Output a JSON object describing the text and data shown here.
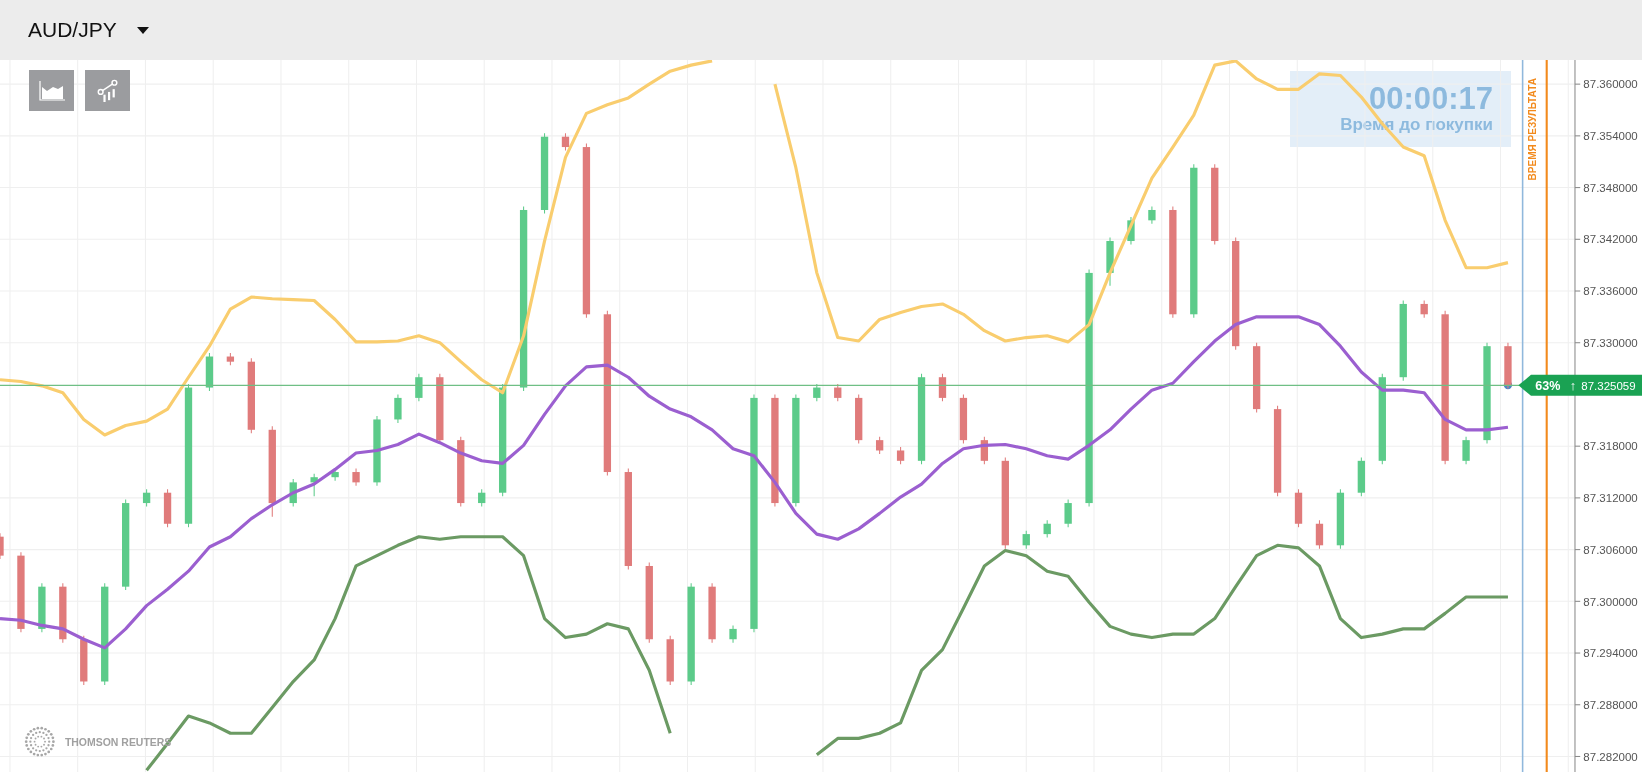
{
  "header": {
    "symbol": "AUD/JPY"
  },
  "timer": {
    "time": "00:00:17",
    "label": "Время до покупки"
  },
  "expiry_label": "ВРЕМЯ РЕЗУЛЬТАТА",
  "price_tag": {
    "percent": "63%",
    "arrow": "↑"
  },
  "provider": "THOMSON REUTERS",
  "chart_data": {
    "type": "candlestick",
    "grid": true,
    "ylim": [
      87.2802,
      87.3628
    ],
    "yticks": [
      {
        "value": 87.36,
        "label": "87.360000"
      },
      {
        "value": 87.354,
        "label": "87.354000"
      },
      {
        "value": 87.348,
        "label": "87.348000"
      },
      {
        "value": 87.342,
        "label": "87.342000"
      },
      {
        "value": 87.336,
        "label": "87.336000"
      },
      {
        "value": 87.33,
        "label": "87.330000"
      },
      {
        "value": 87.318,
        "label": "87.318000"
      },
      {
        "value": 87.312,
        "label": "87.312000"
      },
      {
        "value": 87.306,
        "label": "87.306000"
      },
      {
        "value": 87.3,
        "label": "87.300000"
      },
      {
        "value": 87.294,
        "label": "87.294000"
      },
      {
        "value": 87.288,
        "label": "87.288000"
      },
      {
        "value": 87.282,
        "label": "87.282000"
      }
    ],
    "ohlc": [
      [
        87.3075,
        87.3079,
        87.3049,
        87.3053
      ],
      [
        87.3053,
        87.3057,
        87.2964,
        87.2968
      ],
      [
        87.2968,
        87.3021,
        87.2964,
        87.3017
      ],
      [
        87.3017,
        87.3021,
        87.2952,
        87.2956
      ],
      [
        87.2956,
        87.296,
        87.2903,
        87.2907
      ],
      [
        87.2907,
        87.3021,
        87.2903,
        87.3017
      ],
      [
        87.3017,
        87.3118,
        87.3013,
        87.3114
      ],
      [
        87.3114,
        87.313,
        87.311,
        87.3126
      ],
      [
        87.3126,
        87.313,
        87.3086,
        87.309
      ],
      [
        87.309,
        87.3252,
        87.3086,
        87.3248
      ],
      [
        87.3248,
        87.3288,
        87.3244,
        87.3284
      ],
      [
        87.3284,
        87.3288,
        87.3274,
        87.3278
      ],
      [
        87.3278,
        87.3282,
        87.3195,
        87.3199
      ],
      [
        87.3199,
        87.3203,
        87.3098,
        87.3114
      ],
      [
        87.3114,
        87.3142,
        87.311,
        87.3138
      ],
      [
        87.3138,
        87.3148,
        87.3122,
        87.3144
      ],
      [
        87.3144,
        87.3154,
        87.314,
        87.315
      ],
      [
        87.315,
        87.3154,
        87.3134,
        87.3138
      ],
      [
        87.3138,
        87.3215,
        87.3134,
        87.3211
      ],
      [
        87.3211,
        87.324,
        87.3207,
        87.3236
      ],
      [
        87.3236,
        87.3264,
        87.3232,
        87.326
      ],
      [
        87.326,
        87.3264,
        87.3183,
        87.3187
      ],
      [
        87.3187,
        87.3191,
        87.311,
        87.3114
      ],
      [
        87.3114,
        87.313,
        87.311,
        87.3126
      ],
      [
        87.3126,
        87.3252,
        87.3122,
        87.3248
      ],
      [
        87.3248,
        87.3458,
        87.3244,
        87.3454
      ],
      [
        87.3454,
        87.3543,
        87.345,
        87.3539
      ],
      [
        87.3539,
        87.3543,
        87.3523,
        87.3527
      ],
      [
        87.3527,
        87.3531,
        87.3329,
        87.3333
      ],
      [
        87.3333,
        87.3337,
        87.3146,
        87.315
      ],
      [
        87.315,
        87.3154,
        87.3037,
        87.3041
      ],
      [
        87.3041,
        87.3045,
        87.2952,
        87.2956
      ],
      [
        87.2956,
        87.296,
        87.2903,
        87.2907
      ],
      [
        87.2907,
        87.3021,
        87.2903,
        87.3017
      ],
      [
        87.3017,
        87.3021,
        87.2952,
        87.2956
      ],
      [
        87.2956,
        87.2972,
        87.2952,
        87.2968
      ],
      [
        87.2968,
        87.324,
        87.2964,
        87.3236
      ],
      [
        87.3236,
        87.324,
        87.311,
        87.3114
      ],
      [
        87.3114,
        87.324,
        87.311,
        87.3236
      ],
      [
        87.3236,
        87.3252,
        87.3232,
        87.3248
      ],
      [
        87.3248,
        87.3252,
        87.3232,
        87.3236
      ],
      [
        87.3236,
        87.324,
        87.3183,
        87.3187
      ],
      [
        87.3187,
        87.3191,
        87.3171,
        87.3175
      ],
      [
        87.3175,
        87.3179,
        87.3159,
        87.3163
      ],
      [
        87.3163,
        87.3264,
        87.3159,
        87.326
      ],
      [
        87.326,
        87.3264,
        87.3232,
        87.3236
      ],
      [
        87.3236,
        87.324,
        87.3183,
        87.3187
      ],
      [
        87.3187,
        87.3191,
        87.3159,
        87.3163
      ],
      [
        87.3163,
        87.3167,
        87.3061,
        87.3065
      ],
      [
        87.3065,
        87.3082,
        87.3061,
        87.3078
      ],
      [
        87.3078,
        87.3094,
        87.3074,
        87.309
      ],
      [
        87.309,
        87.3118,
        87.3086,
        87.3114
      ],
      [
        87.3114,
        87.3385,
        87.311,
        87.3381
      ],
      [
        87.3381,
        87.3422,
        87.3366,
        87.3418
      ],
      [
        87.3418,
        87.3446,
        87.3414,
        87.3442
      ],
      [
        87.3442,
        87.3458,
        87.3438,
        87.3454
      ],
      [
        87.3454,
        87.3458,
        87.3329,
        87.3333
      ],
      [
        87.3333,
        87.3507,
        87.3329,
        87.3503
      ],
      [
        87.3503,
        87.3507,
        87.3414,
        87.3418
      ],
      [
        87.3418,
        87.3422,
        87.3292,
        87.3296
      ],
      [
        87.3296,
        87.33,
        87.3219,
        87.3223
      ],
      [
        87.3223,
        87.3227,
        87.3122,
        87.3126
      ],
      [
        87.3126,
        87.313,
        87.3086,
        87.309
      ],
      [
        87.309,
        87.3094,
        87.3061,
        87.3065
      ],
      [
        87.3065,
        87.313,
        87.3061,
        87.3126
      ],
      [
        87.3126,
        87.3167,
        87.3122,
        87.3163
      ],
      [
        87.3163,
        87.3264,
        87.3159,
        87.326
      ],
      [
        87.326,
        87.3349,
        87.3256,
        87.3345
      ],
      [
        87.3345,
        87.3349,
        87.3329,
        87.3333
      ],
      [
        87.3333,
        87.3337,
        87.3159,
        87.3163
      ],
      [
        87.3163,
        87.3191,
        87.3159,
        87.3187
      ],
      [
        87.3187,
        87.33,
        87.3183,
        87.3296
      ],
      [
        87.3296,
        87.33,
        87.3247,
        87.3251
      ]
    ],
    "series": [
      {
        "type": "line",
        "color": "#f9cd6e",
        "values": [
          87.3257,
          87.3255,
          87.325,
          87.3242,
          87.3211,
          87.3193,
          87.3204,
          87.3209,
          87.3223,
          87.326,
          87.3296,
          87.3339,
          87.3353,
          87.3351,
          87.335,
          87.3349,
          87.3327,
          87.3301,
          87.3301,
          87.3302,
          87.3308,
          87.33,
          87.3278,
          87.3257,
          87.3242,
          87.3308,
          87.3418,
          87.3515,
          87.3566,
          87.3576,
          87.3584,
          87.36,
          87.3615,
          87.3622,
          87.3627,
          null,
          null,
          87.36,
          87.3503,
          87.3381,
          87.3306,
          87.3302,
          87.3327,
          87.3335,
          87.3342,
          87.3345,
          87.3333,
          87.3314,
          87.3302,
          87.3306,
          87.3308,
          87.3301,
          87.3321,
          87.3381,
          87.3436,
          87.3491,
          87.3527,
          87.3564,
          87.3622,
          87.3627,
          87.3606,
          87.3594,
          87.3594,
          87.3612,
          87.361,
          87.3585,
          87.3554,
          87.3527,
          87.3517,
          87.3442,
          87.3387,
          87.3387,
          87.3393
        ]
      },
      {
        "type": "line",
        "color": "#9b5fd0",
        "values": [
          87.298,
          87.2978,
          87.2972,
          87.2968,
          87.2956,
          87.2946,
          87.2968,
          87.2995,
          87.3014,
          87.3035,
          87.3063,
          87.3075,
          87.3096,
          87.3112,
          87.3126,
          87.3136,
          87.3153,
          87.3172,
          87.3175,
          87.3182,
          87.3194,
          87.3184,
          87.3172,
          87.3163,
          87.316,
          87.3181,
          87.3217,
          87.325,
          87.3272,
          87.3274,
          87.326,
          87.3238,
          87.3223,
          87.3214,
          87.3199,
          87.3177,
          87.3169,
          87.3138,
          87.3102,
          87.3078,
          87.3072,
          87.3084,
          87.3102,
          87.3121,
          87.3136,
          87.316,
          87.3177,
          87.3181,
          87.3182,
          87.3177,
          87.3169,
          87.3165,
          87.3181,
          87.3199,
          87.3223,
          87.3245,
          87.3253,
          87.3278,
          87.3302,
          87.3321,
          87.333,
          87.333,
          87.333,
          87.3321,
          87.3296,
          87.3266,
          87.3245,
          87.3245,
          87.3242,
          87.3211,
          87.3199,
          87.3199,
          87.3202
        ]
      },
      {
        "type": "line",
        "color": "#6b9a63",
        "values": [
          null,
          null,
          null,
          null,
          null,
          null,
          null,
          87.2804,
          87.2835,
          87.2867,
          87.2859,
          87.2847,
          87.2847,
          87.2877,
          87.2907,
          87.2932,
          87.298,
          87.3041,
          87.3053,
          87.3065,
          87.3075,
          87.3072,
          87.3075,
          87.3075,
          87.3075,
          87.3053,
          87.298,
          87.2958,
          87.2962,
          87.2974,
          87.2968,
          87.292,
          87.2847,
          null,
          null,
          null,
          null,
          null,
          null,
          87.2822,
          87.2841,
          87.2841,
          87.2847,
          87.2859,
          87.292,
          87.2944,
          87.2992,
          87.3041,
          87.3059,
          87.3053,
          87.3035,
          87.3029,
          87.2999,
          87.2971,
          87.2962,
          87.2958,
          87.2962,
          87.2962,
          87.298,
          87.3017,
          87.3053,
          87.3065,
          87.3062,
          87.3041,
          87.298,
          87.2958,
          87.2962,
          87.2968,
          87.2968,
          87.2986,
          87.3005,
          87.3005,
          87.3005
        ]
      }
    ],
    "ref_lines": [
      {
        "axis": "y",
        "value": 87.325059,
        "label": "87.325059",
        "color": "#6fbf85"
      }
    ]
  }
}
